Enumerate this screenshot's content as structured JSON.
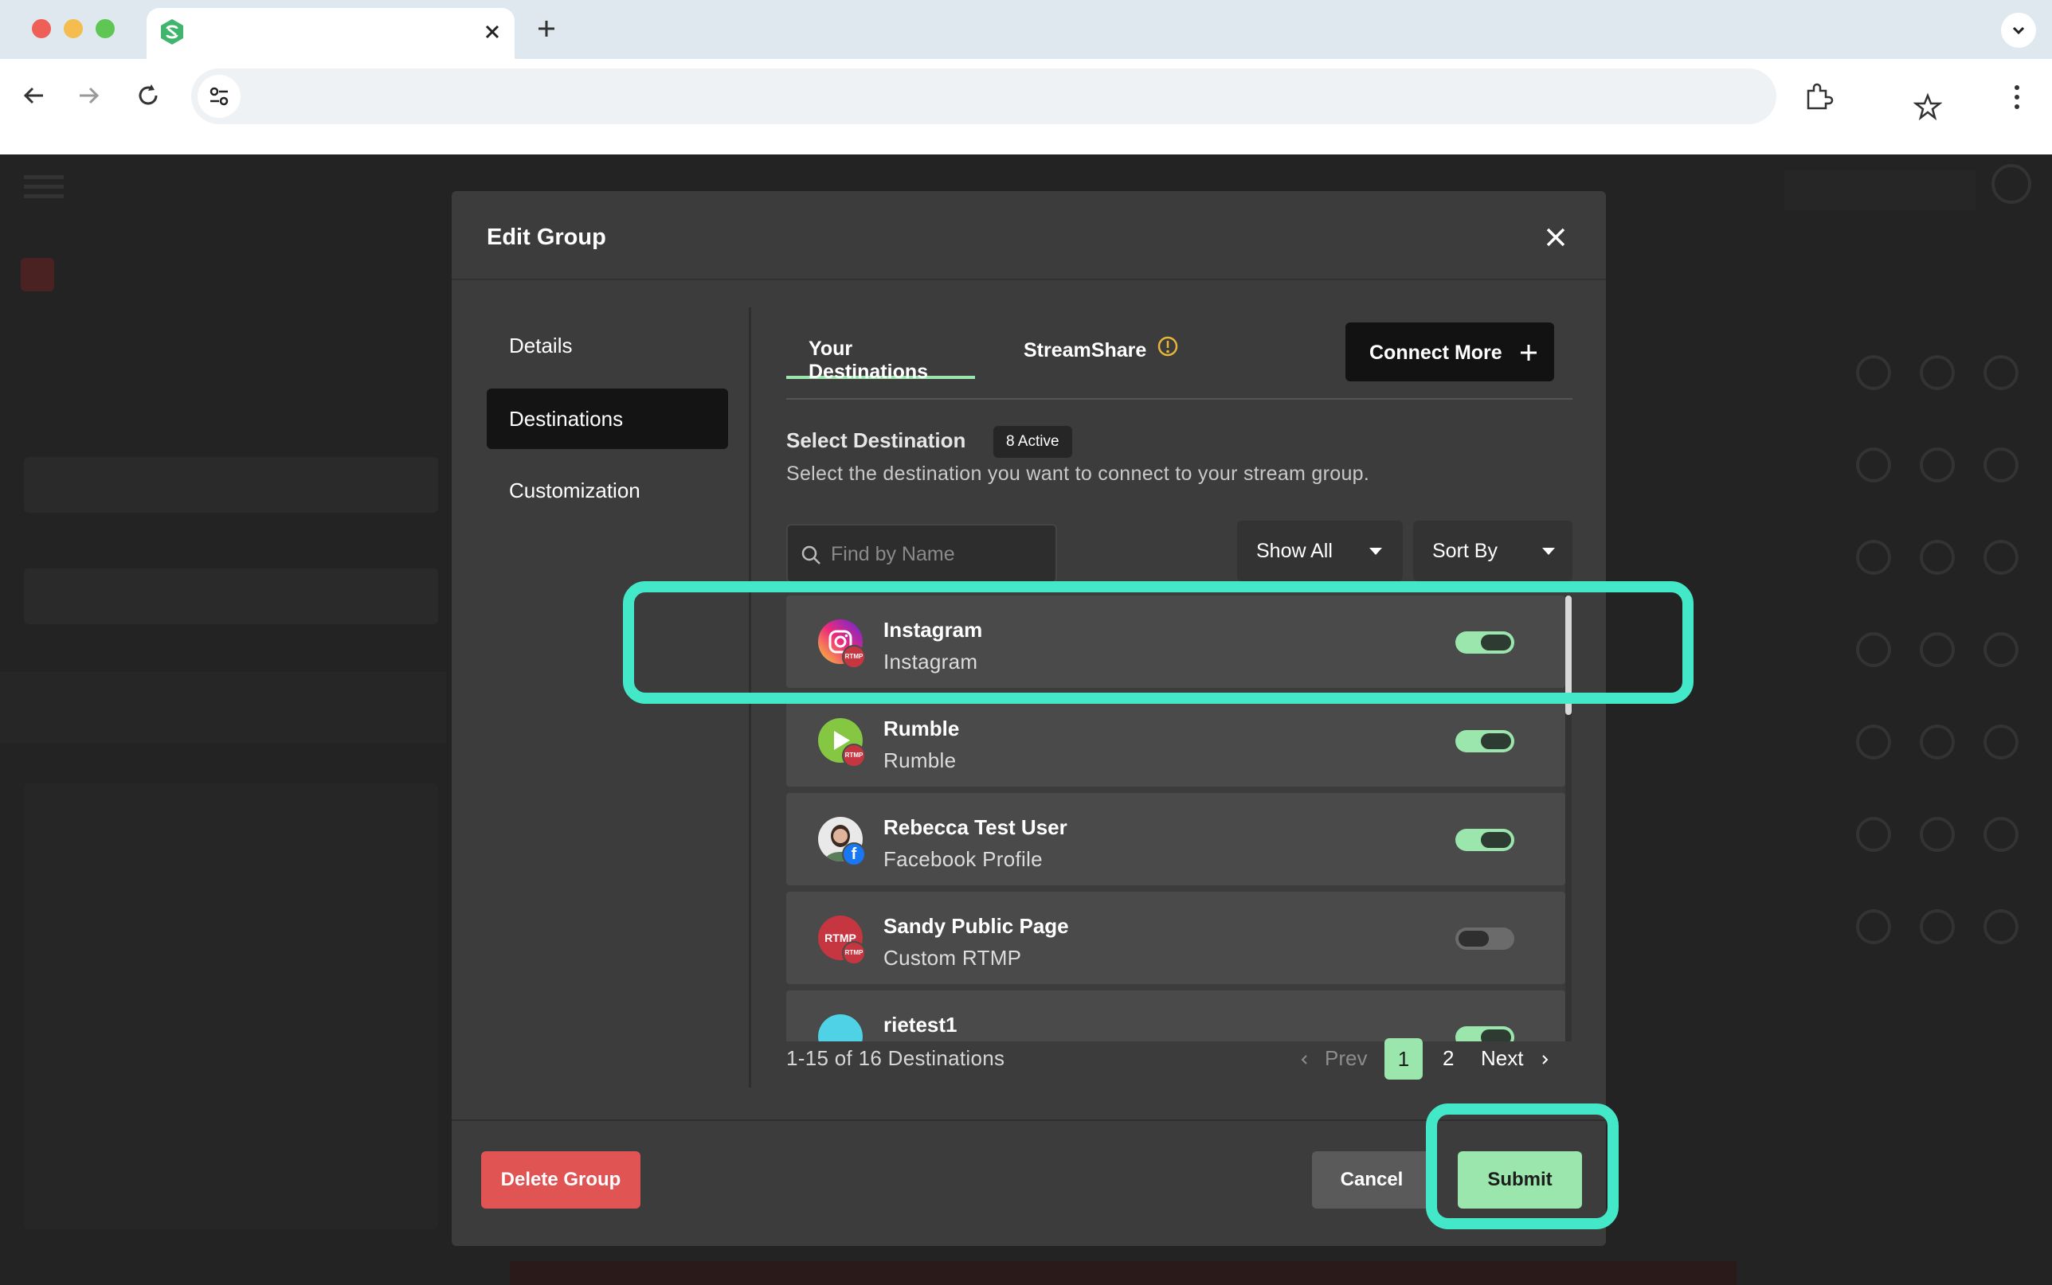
{
  "browser": {
    "tab_close_icon": "close-icon",
    "new_tab_icon": "plus-icon"
  },
  "modal": {
    "title": "Edit Group",
    "sidebar": [
      {
        "label": "Details",
        "active": false
      },
      {
        "label": "Destinations",
        "active": true
      },
      {
        "label": "Customization",
        "active": false
      }
    ],
    "tabs": [
      {
        "label": "Your Destinations",
        "active": true
      },
      {
        "label": "StreamShare",
        "active": false
      }
    ],
    "connect_more_label": "Connect More",
    "select_destination": {
      "title": "Select Destination",
      "badge": "8 Active",
      "subtitle": "Select the destination you want to connect to your stream group."
    },
    "search": {
      "placeholder": "Find by Name",
      "value": ""
    },
    "filter_label": "Show All",
    "sort_label": "Sort By",
    "destinations": [
      {
        "name": "Instagram",
        "type": "Instagram",
        "enabled": true,
        "icon": "instagram-icon",
        "sub_badge": "RTMP"
      },
      {
        "name": "Rumble",
        "type": "Rumble",
        "enabled": true,
        "icon": "rumble-icon",
        "sub_badge": "RTMP"
      },
      {
        "name": "Rebecca Test User",
        "type": "Facebook Profile",
        "enabled": true,
        "icon": "user-avatar",
        "sub_badge": "f"
      },
      {
        "name": "Sandy Public Page",
        "type": "Custom RTMP",
        "enabled": false,
        "icon": "rtmp-icon",
        "icon_text": "RTMP",
        "sub_badge": "RTMP"
      },
      {
        "name": "rietest1",
        "type": "",
        "enabled": true,
        "icon": "rtmp-icon",
        "sub_badge": ""
      }
    ],
    "pagination": {
      "summary": "1-15 of 16 Destinations",
      "prev": "Prev",
      "pages": [
        "1",
        "2"
      ],
      "current": "1",
      "next": "Next"
    },
    "buttons": {
      "delete": "Delete Group",
      "cancel": "Cancel",
      "submit": "Submit"
    }
  },
  "colors": {
    "accent_green": "#9ae6ac",
    "danger_red": "#e05454",
    "highlight": "#43e8c9"
  }
}
